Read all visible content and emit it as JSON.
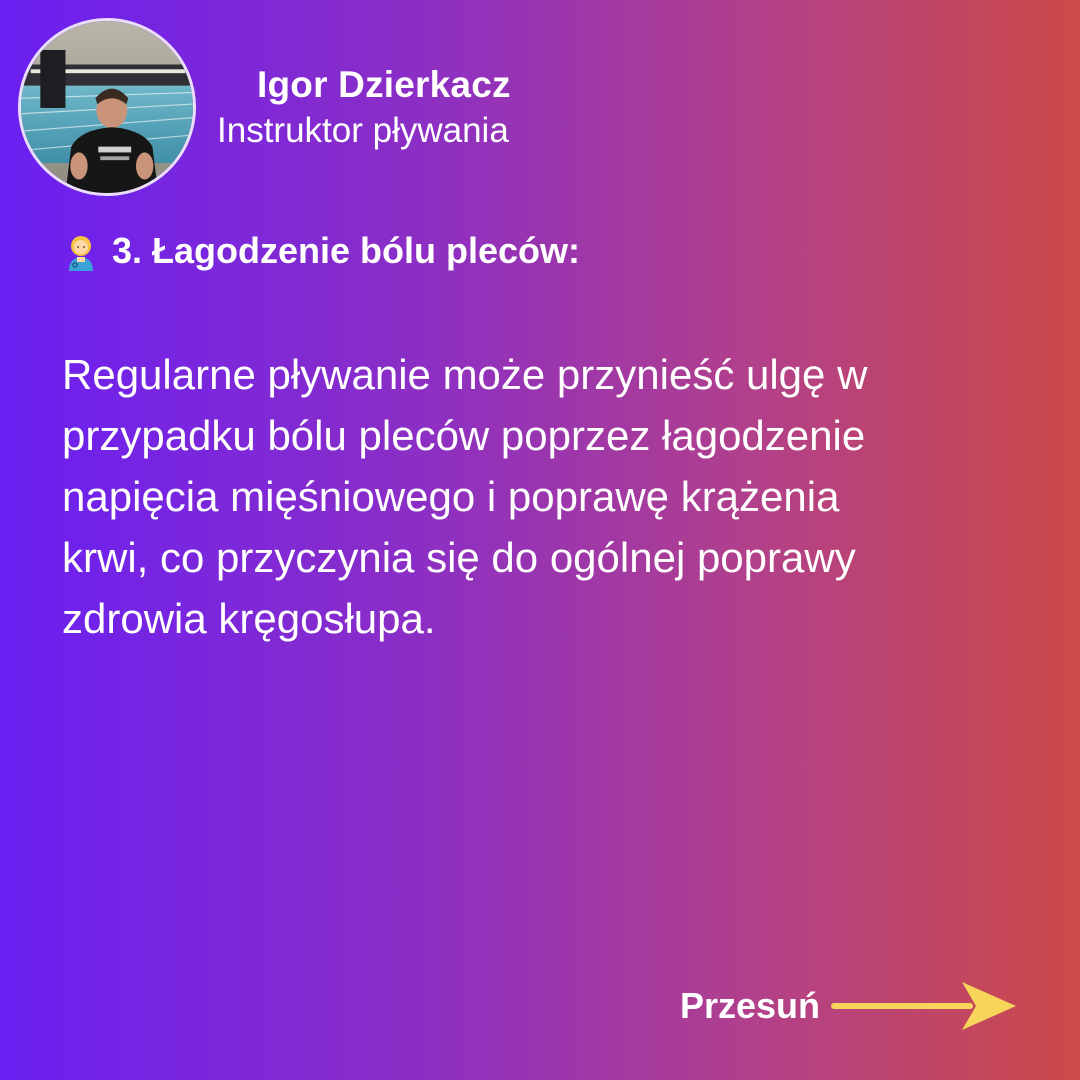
{
  "author": {
    "name": "Igor Dzierkacz",
    "role": "Instruktor pływania",
    "avatar_icon": "profile-photo-at-swimming-pool"
  },
  "section": {
    "icon": "woman-health-worker-emoji",
    "heading": "3. Łagodzenie bólu pleców:"
  },
  "body": {
    "lines": [
      "Regularne pływanie może przynieść ulgę w",
      "przypadku bólu pleców poprzez łagodzenie",
      "napięcia mięśniowego i poprawę krążenia",
      "krwi, co przyczynia się do ogólnej poprawy",
      "zdrowia kręgosłupa."
    ]
  },
  "swipe": {
    "label": "Przesuń",
    "arrow_icon": "arrow-right-icon"
  },
  "colors": {
    "gradient_start": "#6a1ff2",
    "gradient_end": "#cc4a48",
    "text": "#ffffff",
    "arrow": "#f7d45a"
  }
}
